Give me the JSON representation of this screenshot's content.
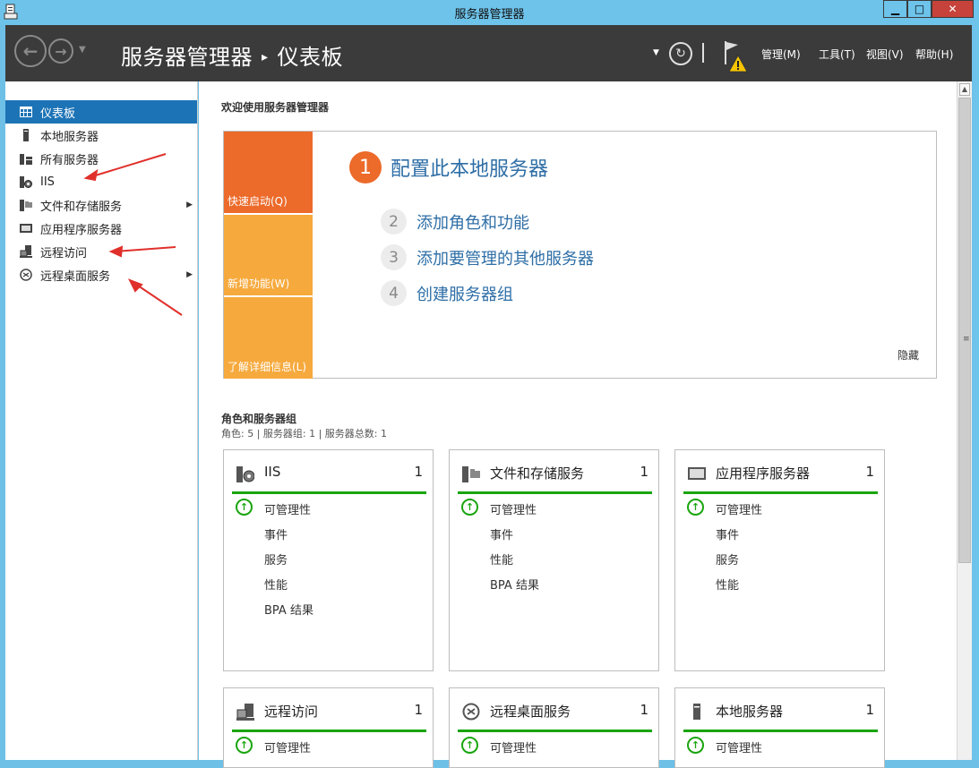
{
  "window": {
    "title": "服务器管理器",
    "min": "▁",
    "max": "□",
    "close": "✕"
  },
  "header": {
    "breadcrumb_root": "服务器管理器",
    "breadcrumb_sep": "▸",
    "breadcrumb_current": "仪表板",
    "menus": [
      "管理(M)",
      "工具(T)",
      "视图(V)",
      "帮助(H)"
    ]
  },
  "sidebar": {
    "items": [
      {
        "label": "仪表板",
        "icon": "dashboard-icon",
        "active": true
      },
      {
        "label": "本地服务器",
        "icon": "server-icon"
      },
      {
        "label": "所有服务器",
        "icon": "servers-icon"
      },
      {
        "label": "IIS",
        "icon": "iis-icon"
      },
      {
        "label": "文件和存储服务",
        "icon": "file-storage-icon",
        "expandable": true
      },
      {
        "label": "应用程序服务器",
        "icon": "app-server-icon"
      },
      {
        "label": "远程访问",
        "icon": "remote-access-icon"
      },
      {
        "label": "远程桌面服务",
        "icon": "remote-desktop-icon",
        "expandable": true
      }
    ]
  },
  "welcome": {
    "title": "欢迎使用服务器管理器",
    "tiles": [
      "快速启动(Q)",
      "新增功能(W)",
      "了解详细信息(L)"
    ],
    "steps": [
      {
        "num": "1",
        "label": "配置此本地服务器"
      },
      {
        "num": "2",
        "label": "添加角色和功能"
      },
      {
        "num": "3",
        "label": "添加要管理的其他服务器"
      },
      {
        "num": "4",
        "label": "创建服务器组"
      }
    ],
    "hide": "隐藏"
  },
  "roles": {
    "title": "角色和服务器组",
    "subtitle": "角色: 5 | 服务器组: 1 | 服务器总数: 1",
    "cards": [
      {
        "name": "IIS",
        "count": "1",
        "icon": "iis-icon",
        "rows": [
          "可管理性",
          "事件",
          "服务",
          "性能",
          "BPA 结果"
        ]
      },
      {
        "name": "文件和存储服务",
        "count": "1",
        "icon": "file-storage-icon",
        "rows": [
          "可管理性",
          "事件",
          "性能",
          "BPA 结果"
        ]
      },
      {
        "name": "应用程序服务器",
        "count": "1",
        "icon": "app-server-icon",
        "rows": [
          "可管理性",
          "事件",
          "服务",
          "性能"
        ]
      },
      {
        "name": "远程访问",
        "count": "1",
        "icon": "remote-access-icon",
        "rows": [
          "可管理性"
        ]
      },
      {
        "name": "远程桌面服务",
        "count": "1",
        "icon": "remote-desktop-icon",
        "rows": [
          "可管理性"
        ]
      },
      {
        "name": "本地服务器",
        "count": "1",
        "icon": "server-icon",
        "rows": [
          "可管理性"
        ]
      }
    ]
  },
  "colors": {
    "accent": "#1c73b6",
    "orange": "#ec6a2a",
    "amber": "#f6a93c",
    "ok_green": "#1aa50f",
    "annotation_red": "#e0302c"
  }
}
